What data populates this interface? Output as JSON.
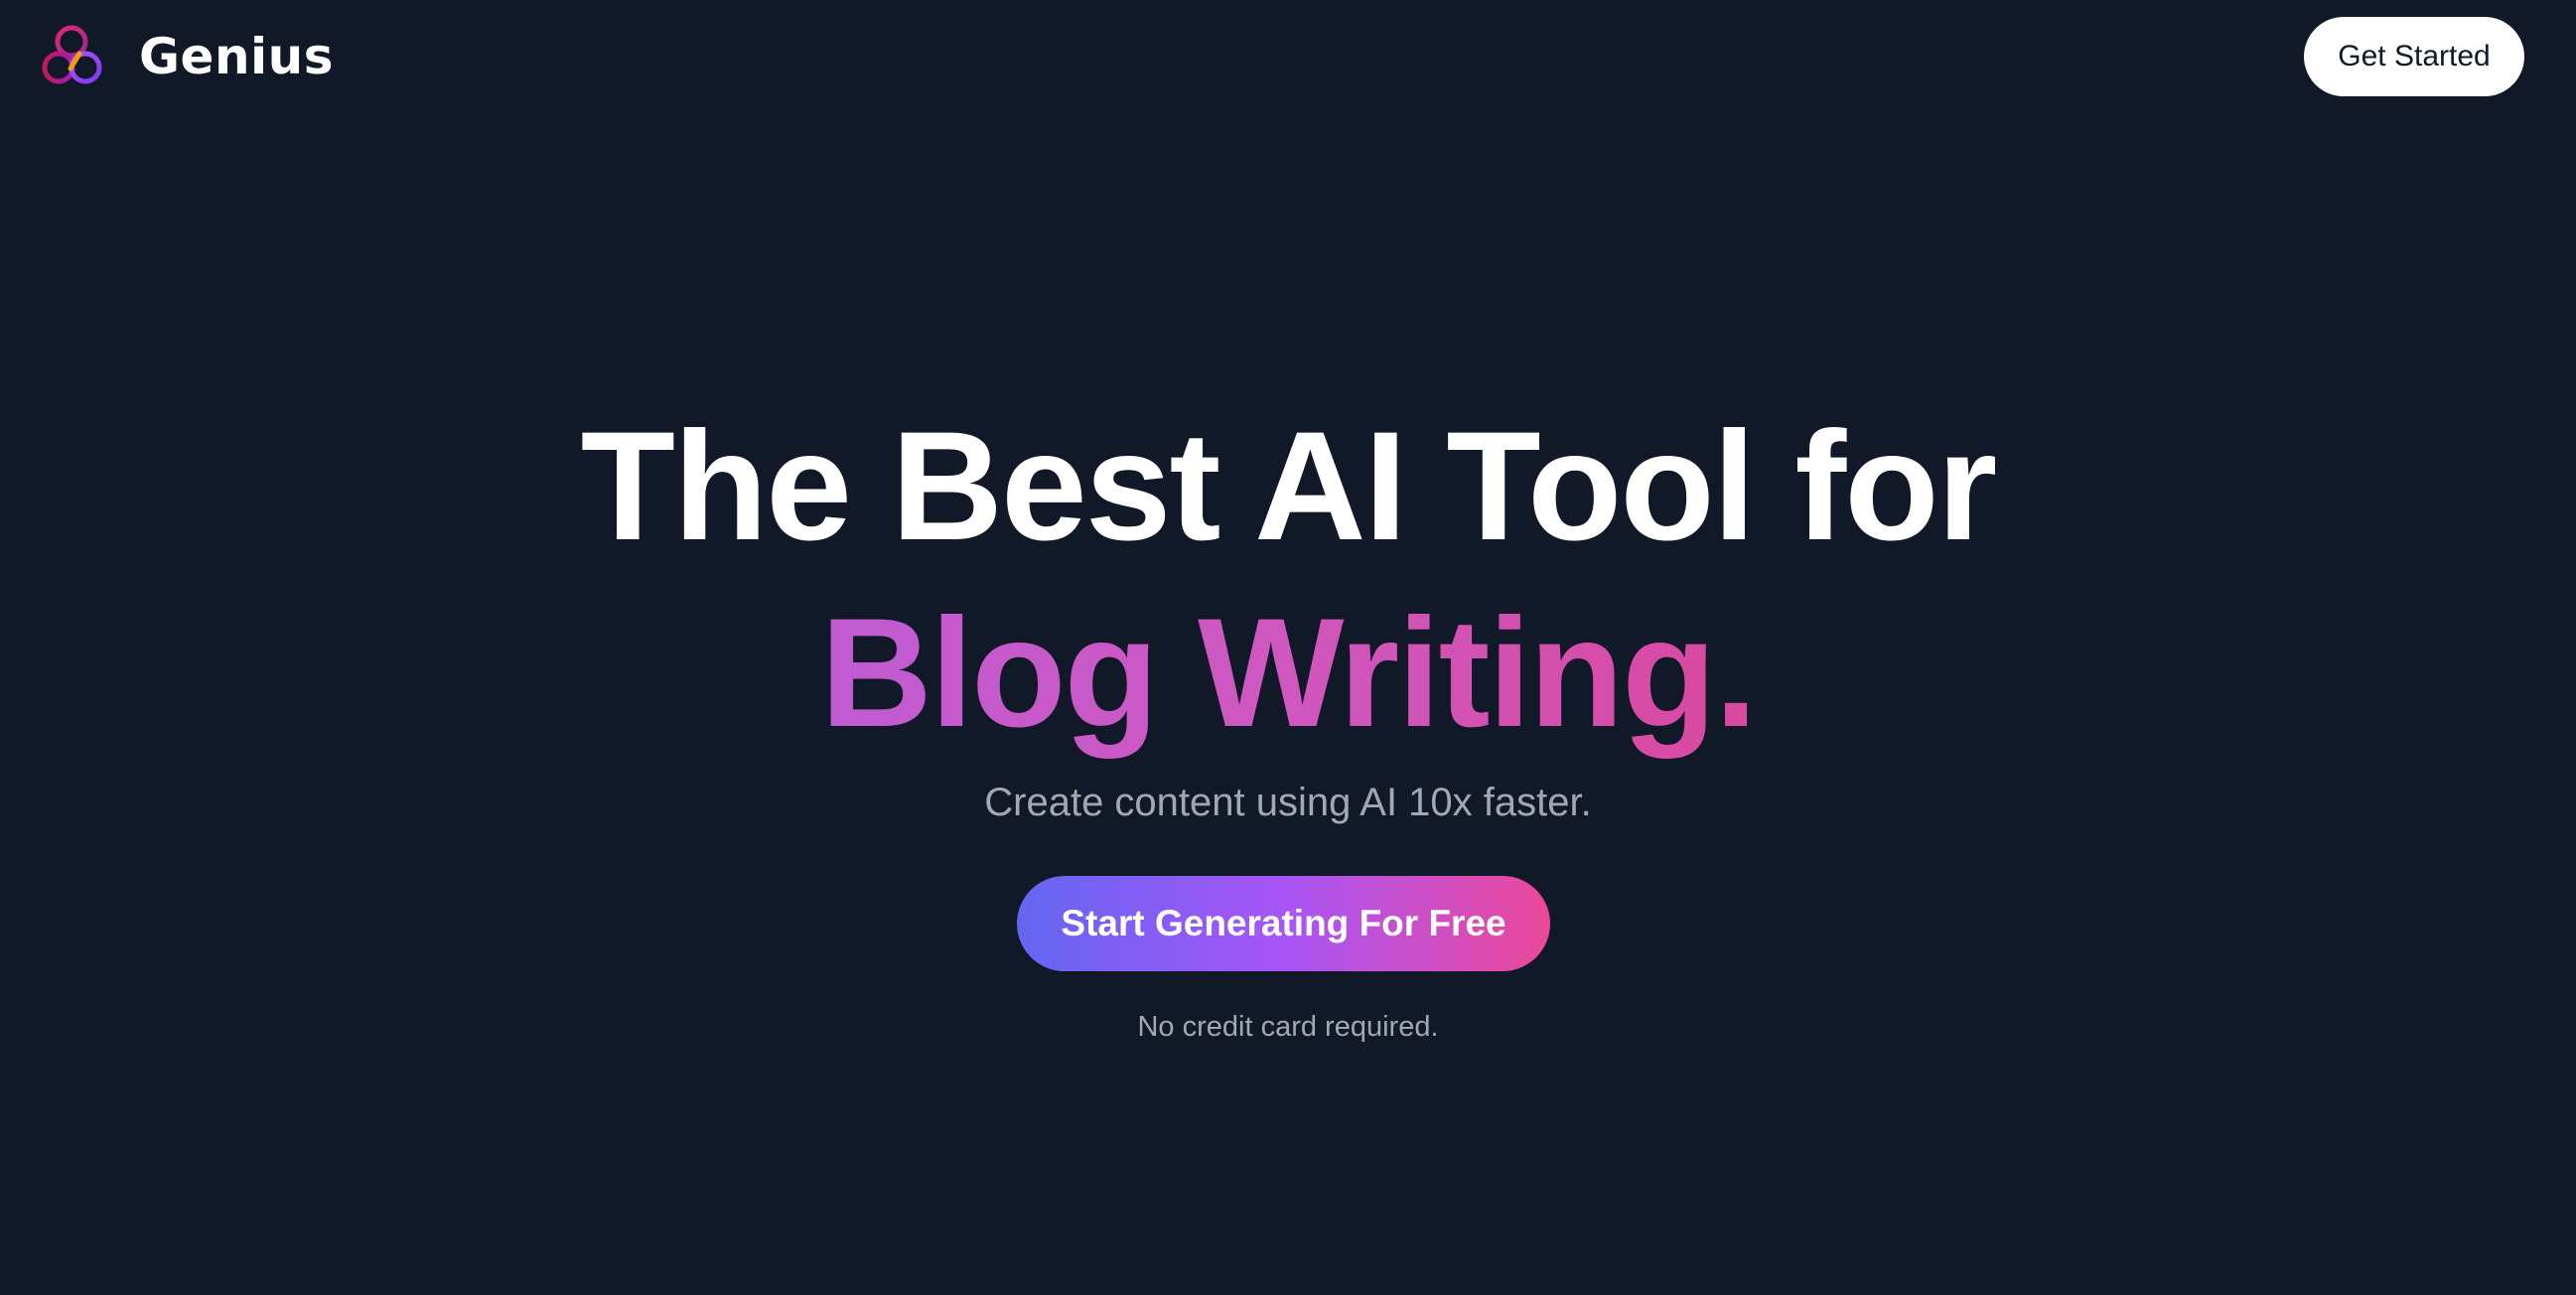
{
  "navbar": {
    "brand_name": "Genius",
    "logo_icon": "genius-interlocking-rings-icon",
    "get_started_label": "Get Started"
  },
  "hero": {
    "title_line_1": "The Best AI Tool for",
    "title_line_2": "Blog Writing.",
    "subtitle": "Create content using AI 10x faster.",
    "cta_label": "Start Generating For Free",
    "note": "No credit card required."
  },
  "colors": {
    "background": "#111827",
    "text_primary": "#ffffff",
    "text_muted": "#a2a8b3",
    "cta_gradient": [
      "#6366f1",
      "#a855f7",
      "#ec4899"
    ],
    "highlight_gradient": [
      "#c05bd3",
      "#d9499f"
    ],
    "logo_colors": [
      "#db2777",
      "#7c3aed",
      "#f59e0b"
    ]
  }
}
